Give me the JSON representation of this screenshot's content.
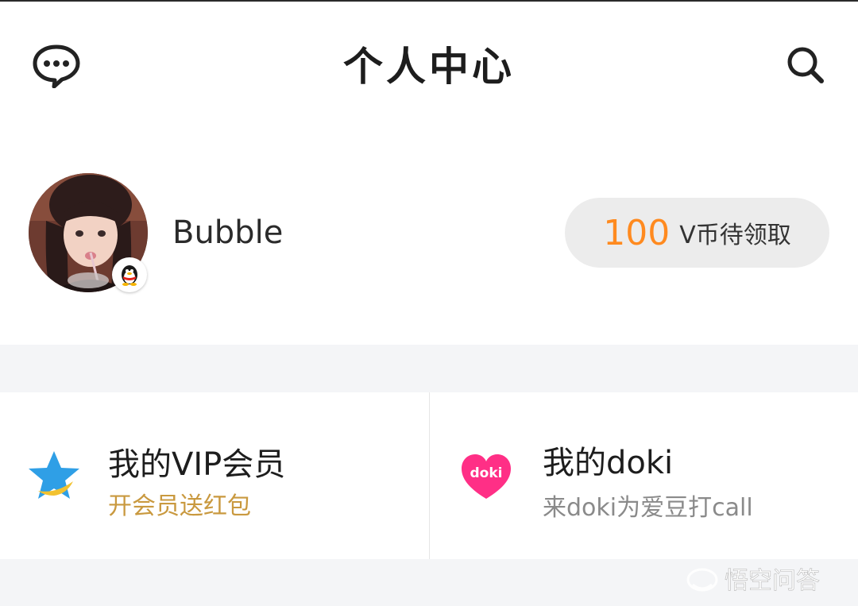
{
  "header": {
    "title": "个人中心",
    "message_icon": "chat-bubble-dots-icon",
    "search_icon": "search-icon"
  },
  "profile": {
    "username": "Bubble",
    "avatar_badge_icon": "qq-penguin-icon",
    "coins": {
      "count": "100",
      "label": "V币待领取",
      "count_color": "#ff8a1f"
    }
  },
  "cards": {
    "vip": {
      "title": "我的VIP会员",
      "subtitle": "开会员送红包",
      "subtitle_color": "#c9993f",
      "icon": "blue-star-icon"
    },
    "doki": {
      "title": "我的doki",
      "subtitle": "来doki为爱豆打call",
      "subtitle_color": "#8a8a8a",
      "icon": "doki-heart-icon",
      "icon_text": "doki",
      "icon_color": "#ff2f86"
    }
  },
  "watermark": {
    "text": "悟空问答"
  }
}
